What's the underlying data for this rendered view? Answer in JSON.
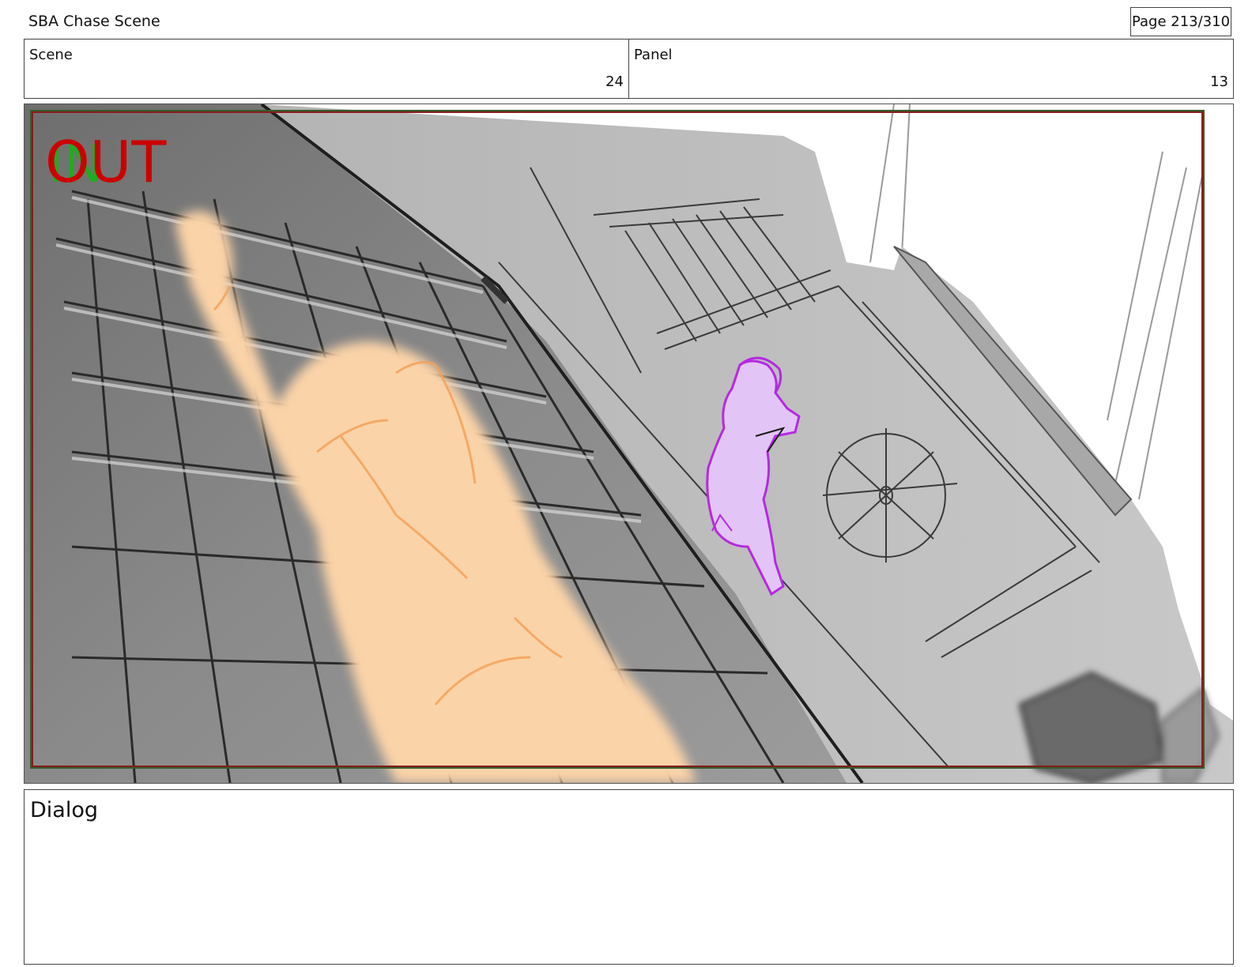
{
  "header": {
    "title": "SBA Chase Scene",
    "page_label": "Page 213/310"
  },
  "info": {
    "scene_label": "Scene",
    "scene_value": "24",
    "panel_label": "Panel",
    "panel_value": "13"
  },
  "panel": {
    "overlay_in": "IN",
    "overlay_out": "OUT",
    "colors": {
      "out_text": "#cc0000",
      "in_text": "#22aa22",
      "character_near": "#f5a25a",
      "character_far": "#b52ae0",
      "frame_safe": "#8b1a1a"
    }
  },
  "dialog": {
    "label": "Dialog"
  }
}
